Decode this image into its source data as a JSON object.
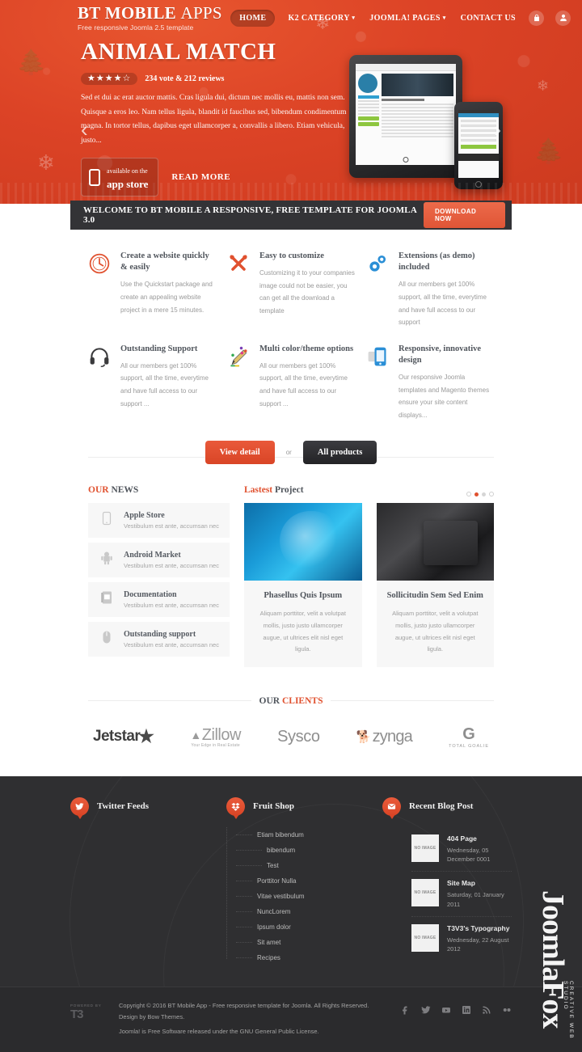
{
  "header": {
    "brand_title_bold": "BT MOBILE ",
    "brand_title_light": "APPS",
    "brand_sub": "Free responsive Joomla 2.5 template",
    "nav": [
      {
        "label": "HOME",
        "caret": "",
        "active": true
      },
      {
        "label": "K2 CATEGORY",
        "caret": "▾",
        "active": false
      },
      {
        "label": "JOOMLA! PAGES",
        "caret": "▾",
        "active": false
      },
      {
        "label": "CONTACT US",
        "caret": "",
        "active": false
      }
    ],
    "icons": [
      "lock-icon",
      "user-icon"
    ],
    "accent_color": "#e0512f",
    "header_bg": "#dc4326"
  },
  "hero": {
    "title": "ANIMAL MATCH",
    "stars": "★★★★☆",
    "rating_text": "234 vote & 212 reviews",
    "description": "Sed et dui ac erat auctor mattis. Cras ligula dui, dictum nec mollis eu, mattis non sem. Quisque a eros leo. Nam tellus ligula, blandit id faucibus sed, bibendum condimentum magna. In tortor tellus, dapibus eget ullamcorper a, convallis a libero. Etiam vehicula, justo...",
    "appstore_line1": "available on the",
    "appstore_line2": "app store",
    "read_more": "READ MORE",
    "arrow_left": "‹",
    "arrow_right": "›"
  },
  "welcome": {
    "text": "WELCOME TO BT MOBILE A RESPONSIVE, FREE TEMPLATE FOR JOOMLA 3.0",
    "button": "DOWNLOAD NOW"
  },
  "features": [
    {
      "icon": "clock-icon",
      "title": "Create a website quickly & easily",
      "desc": "Use the Quickstart package and create an appealing website project in a mere 15 minutes."
    },
    {
      "icon": "tools-icon",
      "title": "Easy to customize",
      "desc": "Customizing it to your companies image could not be easier, you can get all the download a template"
    },
    {
      "icon": "gears-icon",
      "title": "Extensions (as demo) included",
      "desc": "All our members get 100% support, all the time, everytime and have full access to our support"
    },
    {
      "icon": "headphones-icon",
      "title": "Outstanding Support",
      "desc": "All our members get 100% support, all the time, everytime and have full access to our support ..."
    },
    {
      "icon": "pencil-palette-icon",
      "title": "Multi color/theme options",
      "desc": "All our members get 100% support, all the time, everytime and have full access to our support ..."
    },
    {
      "icon": "mobile-icon",
      "title": "Responsive, innovative design",
      "desc": "Our responsive Joomla templates and Magento themes ensure your site content displays..."
    }
  ],
  "cta": {
    "view_detail": "View detail",
    "or": "or",
    "all_products": "All products"
  },
  "news": {
    "title_accent": "OUR",
    "title_rest": " NEWS",
    "items": [
      {
        "icon": "mobile-icon",
        "title": "Apple Store",
        "sub": "Vestibulum est ante, accumsan nec"
      },
      {
        "icon": "android-icon",
        "title": "Android Market",
        "sub": "Vestibulum est ante, accumsan nec"
      },
      {
        "icon": "book-icon",
        "title": "Documentation",
        "sub": "Vestibulum est ante, accumsan nec"
      },
      {
        "icon": "mouse-icon",
        "title": "Outstanding support",
        "sub": "Vestibulum est ante, accumsan nec"
      }
    ]
  },
  "projects": {
    "title_accent": "Lastest",
    "title_rest": " Project",
    "dots": [
      {
        "state": "ring"
      },
      {
        "state": "active"
      },
      {
        "state": "plain"
      },
      {
        "state": "ring"
      }
    ],
    "cards": [
      {
        "title": "Phasellus Quis Ipsum",
        "desc": "Aliquam porttitor, velit a volutpat mollis, justo justo ullamcorper augue, ut ultrices elit nisl eget ligula."
      },
      {
        "title": "Sollicitudin Sem Sed Enim",
        "desc": "Aliquam porttitor, velit a volutpat mollis, justo justo ullamcorper augue, ut ultrices elit nisl eget ligula."
      }
    ]
  },
  "clients": {
    "title_plain": "OUR ",
    "title_accent": "CLIENTS",
    "logos": [
      {
        "name": "Jetstar",
        "sub": ""
      },
      {
        "name": "Zillow",
        "sub": "Your Edge in Real Estate"
      },
      {
        "name": "Sysco",
        "sub": ""
      },
      {
        "name": "zynga",
        "sub": ""
      },
      {
        "name": "G",
        "sub": "TOTAL GOALIE"
      }
    ]
  },
  "footer": {
    "twitter": {
      "icon": "twitter-icon",
      "title": "Twitter Feeds"
    },
    "fruitshop": {
      "icon": "dropbox-icon",
      "title": "Fruit Shop",
      "items": [
        {
          "label": "Etiam bibendum",
          "indent": false
        },
        {
          "label": "bibendum",
          "indent": true
        },
        {
          "label": "Test",
          "indent": true
        },
        {
          "label": "Porttitor Nulla",
          "indent": false
        },
        {
          "label": "Vitae vestibulum",
          "indent": false
        },
        {
          "label": "NuncLorem",
          "indent": false
        },
        {
          "label": "Ipsum dolor",
          "indent": false
        },
        {
          "label": "Sit amet",
          "indent": false
        },
        {
          "label": "Recipes",
          "indent": false
        }
      ]
    },
    "blog": {
      "icon": "envelope-icon",
      "title": "Recent Blog Post",
      "noimage_label": "NO IMAGE",
      "posts": [
        {
          "title": "404 Page",
          "date": "Wednesday, 05 December 0001"
        },
        {
          "title": "Site Map",
          "date": "Saturday, 01 January 2011"
        },
        {
          "title": "T3V3's Typography",
          "date": "Wednesday, 22 August 2012"
        }
      ]
    },
    "watermark": {
      "text": "JoomlaFox",
      "sub": "CREATIVE WEB STUDIO"
    },
    "t3_logo_top": "POWERED BY",
    "t3_logo_main": "T3",
    "copyright_line1": "Copyright © 2016 BT Mobile App - Free responsive template for Joomla. All Rights Reserved.",
    "copyright_line2": "Design by Bow Themes.",
    "copyright_line3": "Joomla! is Free Software released under the GNU General Public License.",
    "socials": [
      "facebook-icon",
      "twitter-icon",
      "youtube-icon",
      "linkedin-icon",
      "rss-icon",
      "flickr-icon"
    ]
  }
}
